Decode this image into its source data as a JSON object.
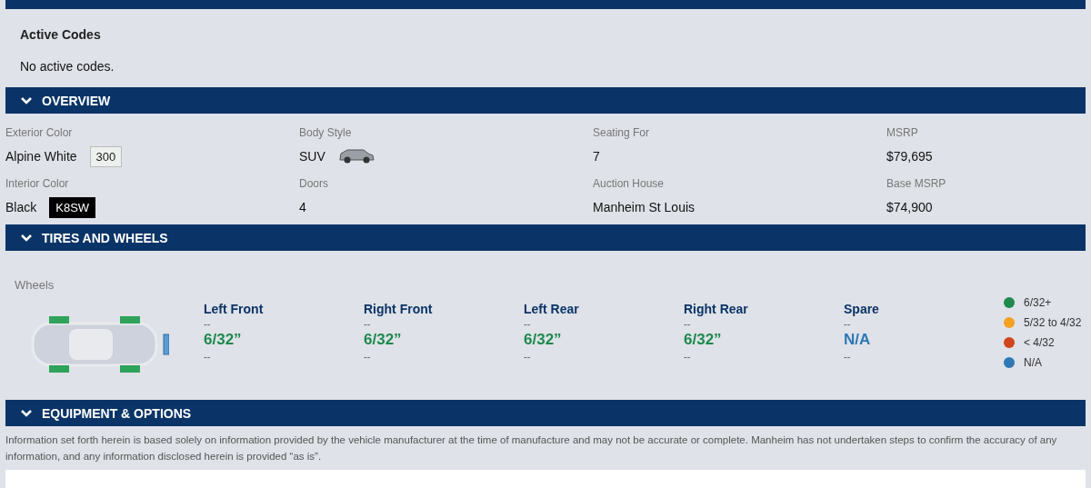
{
  "active_codes": {
    "title": "Active Codes",
    "message": "No active codes."
  },
  "overview": {
    "title": "OVERVIEW",
    "expanded": true,
    "fields": [
      {
        "label": "Exterior Color",
        "value": "Alpine White",
        "code": "300",
        "kind": "swatch-light"
      },
      {
        "label": "Body Style",
        "value": "SUV",
        "kind": "vehicle"
      },
      {
        "label": "Seating For",
        "value": "7"
      },
      {
        "label": "MSRP",
        "value": "$79,695"
      },
      {
        "label": "Interior Color",
        "value": "Black",
        "code": "K8SW",
        "kind": "swatch-dark"
      },
      {
        "label": "Doors",
        "value": "4"
      },
      {
        "label": "Auction House",
        "value": "Manheim St Louis"
      },
      {
        "label": "Base MSRP",
        "value": "$74,900"
      }
    ]
  },
  "tires": {
    "title": "TIRES AND WHEELS",
    "expanded": true,
    "label": "Wheels",
    "positions": [
      {
        "name": "Left Front",
        "above": "--",
        "depth": "6/32”",
        "below": "--",
        "color": "#1e8a4c"
      },
      {
        "name": "Right Front",
        "above": "--",
        "depth": "6/32”",
        "below": "--",
        "color": "#1e8a4c"
      },
      {
        "name": "Left Rear",
        "above": "--",
        "depth": "6/32”",
        "below": "--",
        "color": "#1e8a4c"
      },
      {
        "name": "Right Rear",
        "above": "--",
        "depth": "6/32”",
        "below": "--",
        "color": "#1e8a4c"
      },
      {
        "name": "Spare",
        "above": "--",
        "depth": "N/A",
        "below": "--",
        "color": "#2f78b4"
      }
    ],
    "legend": [
      {
        "label": "6/32+",
        "color": "#1e8a4c"
      },
      {
        "label": "5/32 to 4/32",
        "color": "#f5a020"
      },
      {
        "label": "< 4/32",
        "color": "#d0451b"
      },
      {
        "label": "N/A",
        "color": "#2f78b4"
      }
    ]
  },
  "equipment": {
    "title": "EQUIPMENT & OPTIONS",
    "expanded": true,
    "disclaimer": "Information set forth herein is based solely on information provided by the vehicle manufacturer at the time of manufacture and may not be accurate or complete. Manheim has not undertaken steps to confirm the accuracy of any information, and any information disclosed herein is provided “as is”."
  }
}
